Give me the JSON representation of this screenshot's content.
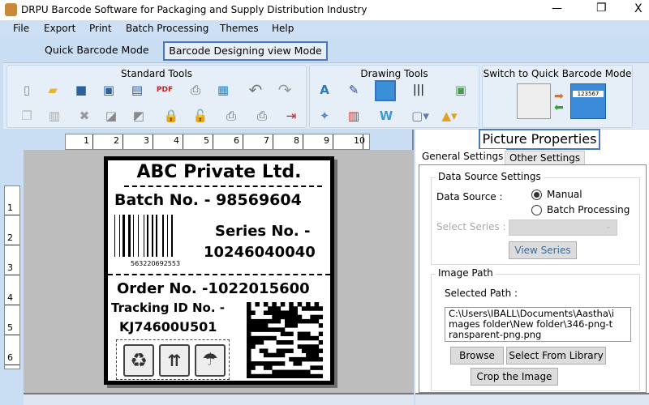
{
  "window": {
    "title": "DRPU Barcode Software for Packaging and Supply Distribution Industry",
    "minimize": "—",
    "restore": "❐",
    "close": "X"
  },
  "menu": [
    "File",
    "Export",
    "Print",
    "Batch Processing",
    "Themes",
    "Help"
  ],
  "modes": {
    "quick": "Quick Barcode Mode",
    "designing": "Barcode Designing view Mode"
  },
  "toolbar": {
    "standard": "Standard Tools",
    "drawing": "Drawing Tools",
    "switch": "Switch to Quick Barcode Mode",
    "switch_preview": "123567"
  },
  "rulers": {
    "h": [
      "1",
      "2",
      "3",
      "4",
      "5",
      "6",
      "7",
      "8",
      "9",
      "10"
    ],
    "v": [
      "1",
      "2",
      "3",
      "4",
      "5",
      "6"
    ]
  },
  "label": {
    "company": "ABC Private Ltd.",
    "batch": "Batch No. - 98569604",
    "barcode_text": "563220692553",
    "series_label": "Series No. -",
    "series_value": "10246040040",
    "order": "Order No. -1022015600",
    "tracking_label": "Tracking ID No. -",
    "tracking_value": "KJ74600U501"
  },
  "panel": {
    "title": "Picture Properties",
    "tabs": [
      "General Settings",
      "Other Settings"
    ],
    "data_source_settings": "Data Source Settings",
    "data_source_label": "Data Source :",
    "radio_manual": "Manual",
    "radio_batch": "Batch Processing",
    "selected_radio": "Manual",
    "select_series_label": "Select Series :",
    "select_series_value": "",
    "view_series": "View Series",
    "image_path": "Image Path",
    "selected_path_label": "Selected Path :",
    "path_value": "C:\\Users\\IBALL\\Documents\\Aastha\\images folder\\New folder\\346-png-transparent-png.png",
    "browse": "Browse",
    "select_library": "Select From Library",
    "crop": "Crop the Image"
  }
}
